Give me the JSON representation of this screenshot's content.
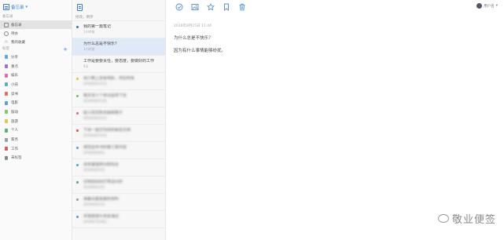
{
  "sidebar": {
    "notebook_title": "备忘录",
    "section_memo": "备忘录",
    "items": [
      {
        "label": "备忘录",
        "icon": "notebook-icon",
        "active": true
      },
      {
        "label": "待办",
        "icon": "todo-icon",
        "active": false
      },
      {
        "label": "我的收藏",
        "icon": "star-icon",
        "active": false
      }
    ],
    "section_tags": "标签",
    "categories": [
      {
        "label": "分享",
        "color": "#5aa6e8"
      },
      {
        "label": "重点",
        "color": "#9b6fd6"
      },
      {
        "label": "娱乐",
        "color": "#e06aa0"
      },
      {
        "label": "小孩",
        "color": "#4fb3c8"
      },
      {
        "label": "读书",
        "color": "#e0705a"
      },
      {
        "label": "电影",
        "color": "#5aa0e0"
      },
      {
        "label": "鼓动",
        "color": "#7cc66b"
      },
      {
        "label": "旅游",
        "color": "#e6c34f"
      },
      {
        "label": "个人",
        "color": "#58b07a"
      },
      {
        "label": "家务",
        "color": "#9aa0a8"
      },
      {
        "label": "工作",
        "color": "#e05a5a"
      },
      {
        "label": "未标签",
        "color": "#888888"
      }
    ]
  },
  "list": {
    "sort_label": "修改，倒序",
    "notes": [
      {
        "title": "我的第一篇笔记",
        "date": "1小时前",
        "marker": "#3a7bd5",
        "selected": false,
        "blur": false
      },
      {
        "title": "为什么总是不快乐？",
        "date": "1小时前",
        "marker": "",
        "selected": true,
        "blur": false
      },
      {
        "title": "工作是要要责任，要态度，要做好的工作",
        "date": "4天",
        "marker": "",
        "selected": false,
        "blur": false
      },
      {
        "title": "周六晚上去看电影，然后吃饭",
        "date": "2016年8月15日",
        "marker": "#e6c34f",
        "selected": false,
        "blur": true
      },
      {
        "title": "每天背十个单词坚持下去",
        "date": "2016年8月13日",
        "marker": "#7cc66b",
        "selected": false,
        "blur": true
      },
      {
        "title": "给小孩买新衣服和鞋子",
        "date": "2016年8月12日",
        "marker": "#e06aa0",
        "selected": false,
        "blur": true
      },
      {
        "title": "下周一提交项目的报告文档",
        "date": "2016年8月10日",
        "marker": "#e05a5a",
        "selected": false,
        "blur": true
      },
      {
        "title": "读完这本书的第三章内容",
        "date": "2016年8月8日",
        "marker": "#5aa6e8",
        "selected": false,
        "blur": true
      },
      {
        "title": "周末整理房间和阳台",
        "date": "2016年8月5日",
        "marker": "#4fb3c8",
        "selected": false,
        "blur": true
      },
      {
        "title": "记得给妈妈打电话问好",
        "date": "2016年8月3日",
        "marker": "#58b07a",
        "selected": false,
        "blur": true
      },
      {
        "title": "准备出差需要的资料",
        "date": "2016年8月1日",
        "marker": "#9aa0a8",
        "selected": false,
        "blur": true
      },
      {
        "title": "年底旅游计划去海边",
        "date": "2016年7月28日",
        "marker": "#5aa0e0",
        "selected": false,
        "blur": true
      }
    ]
  },
  "toolbar": {
    "icons": [
      "check-circle-icon",
      "image-icon",
      "star-icon",
      "bookmark-icon",
      "trash-icon"
    ],
    "user_name": "用户名"
  },
  "editor": {
    "date": "2016年8月15日 11:44",
    "title": "为什么总是不快乐？",
    "body": "因为有什么事情能够纷扰。"
  },
  "watermark": {
    "text": "敬业便签"
  }
}
